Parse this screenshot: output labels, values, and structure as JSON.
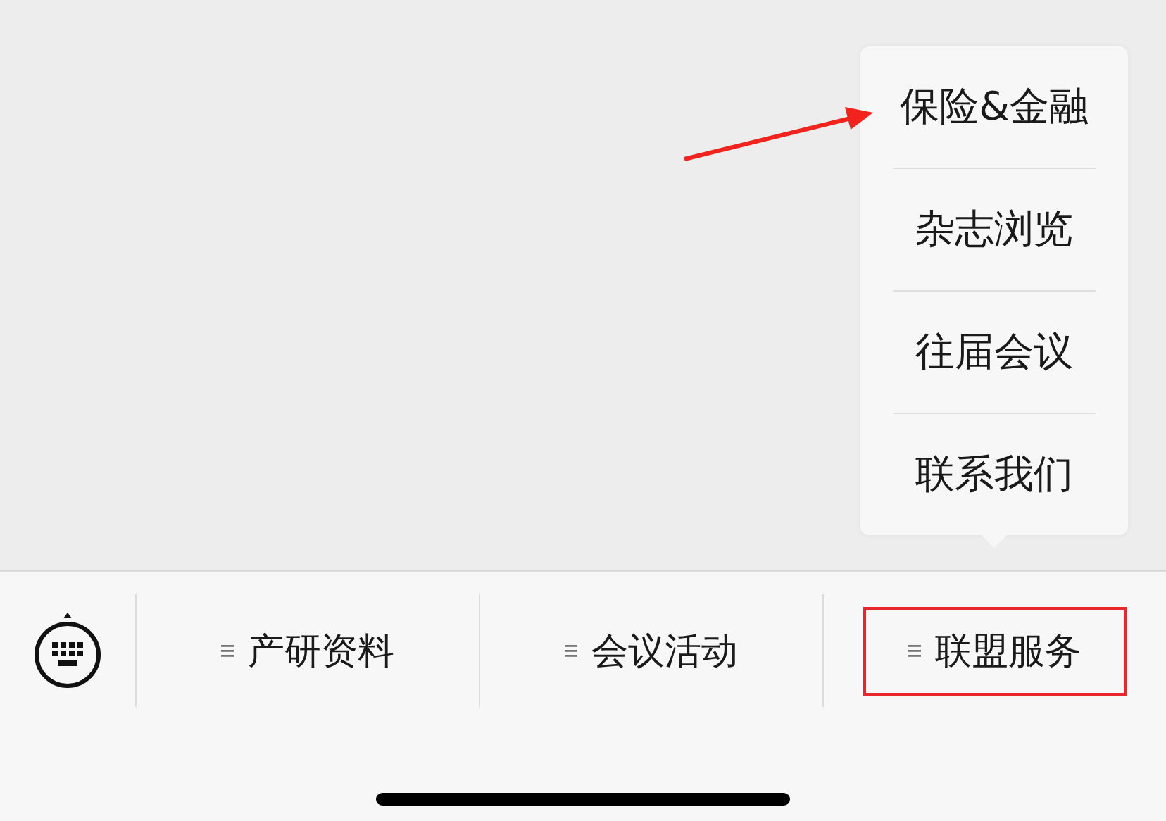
{
  "popup_menu": {
    "items": [
      {
        "label": "保险&金融"
      },
      {
        "label": "杂志浏览"
      },
      {
        "label": "往届会议"
      },
      {
        "label": "联系我们"
      }
    ]
  },
  "bottom_menu": {
    "items": [
      {
        "label": "产研资料",
        "highlighted": false
      },
      {
        "label": "会议活动",
        "highlighted": false
      },
      {
        "label": "联盟服务",
        "highlighted": true
      }
    ]
  },
  "annotations": [
    {
      "kind": "arrow"
    }
  ]
}
